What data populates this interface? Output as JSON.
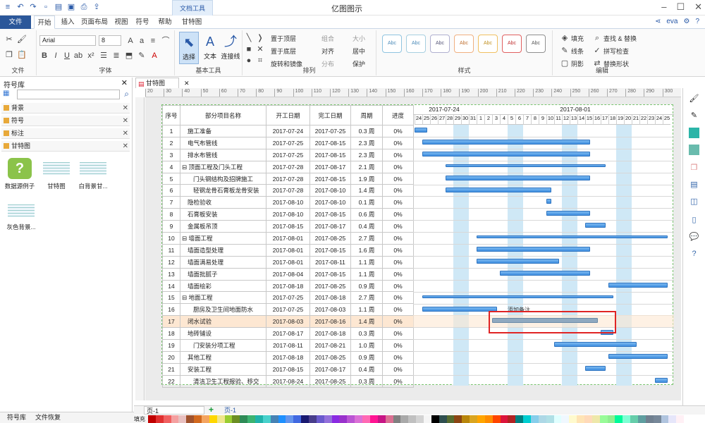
{
  "app": {
    "title": "亿图图示",
    "context_tab": "文档工具",
    "user": "eva"
  },
  "menu": {
    "file": "文件",
    "tabs": [
      "开始",
      "插入",
      "页面布局",
      "视图",
      "符号",
      "帮助",
      "甘特图"
    ]
  },
  "ribbon": {
    "font_name": "Arial",
    "font_size": "8",
    "groups": {
      "file": "文件",
      "font": "字体",
      "basic": "基本工具",
      "arrange": "排列",
      "style": "样式",
      "edit": "编辑"
    },
    "basic_tools": {
      "select": "选择",
      "text": "文本",
      "connector": "连接线"
    },
    "arrange": {
      "bring_front": "置于顶层",
      "send_back": "置于底层",
      "rotate": "旋转和镜像",
      "group": "组合",
      "align": "对齐",
      "distribute": "分布",
      "size": "大小",
      "center": "居中",
      "protect": "保护"
    },
    "style_label": "Abc",
    "right": {
      "fill": "填充",
      "line": "线条",
      "shadow": "阴影",
      "find_replace": "查找 & 替换",
      "spell": "拼写检查",
      "replace_shape": "替换形状"
    }
  },
  "sidebar": {
    "title": "符号库",
    "sections": [
      "背景",
      "符号",
      "标注",
      "甘特图"
    ],
    "thumbs": [
      "数据源例子",
      "甘特图",
      "白背景甘...",
      "灰色背景..."
    ],
    "bottom_tabs": [
      "符号库",
      "文件恢复"
    ]
  },
  "document_tab": "甘特图",
  "ruler_marks": [
    "20",
    "30",
    "40",
    "50",
    "60",
    "70",
    "80",
    "90",
    "100",
    "110",
    "120",
    "130",
    "140",
    "150",
    "160",
    "170",
    "180",
    "190",
    "200",
    "210",
    "220",
    "230",
    "240",
    "250",
    "260",
    "270",
    "280",
    "290",
    "300"
  ],
  "gantt": {
    "headers": [
      "序号",
      "部分项目名称",
      "开工日期",
      "完工日期",
      "周期",
      "进度"
    ],
    "period1": "2017-07-24",
    "period2": "2017-08-01",
    "days": [
      "24",
      "25",
      "26",
      "27",
      "28",
      "29",
      "30",
      "31",
      "1",
      "2",
      "3",
      "4",
      "5",
      "6",
      "7",
      "8",
      "9",
      "10",
      "11",
      "12",
      "13",
      "14",
      "15",
      "16",
      "17",
      "18",
      "19",
      "20",
      "21",
      "22",
      "23",
      "24",
      "25"
    ],
    "note": "添加备注",
    "rows": [
      {
        "id": "1",
        "name": "施工准备",
        "start": "2017-07-24",
        "end": "2017-07-25",
        "dur": "0.3 周",
        "pct": "0%"
      },
      {
        "id": "2",
        "name": "电气布管线",
        "start": "2017-07-25",
        "end": "2017-08-15",
        "dur": "2.3 周",
        "pct": "0%"
      },
      {
        "id": "3",
        "name": "排水布管线",
        "start": "2017-07-25",
        "end": "2017-08-15",
        "dur": "2.3 周",
        "pct": "0%"
      },
      {
        "id": "4",
        "name": "⊟ 顶面工程及门头工程",
        "start": "2017-07-28",
        "end": "2017-08-17",
        "dur": "2.1 周",
        "pct": "0%"
      },
      {
        "id": "5",
        "name": "门头钢结构及招牌施工",
        "start": "2017-07-28",
        "end": "2017-08-15",
        "dur": "1.9 周",
        "pct": "0%"
      },
      {
        "id": "6",
        "name": "轻钢龙骨石膏板龙骨安装",
        "start": "2017-07-28",
        "end": "2017-08-10",
        "dur": "1.4 周",
        "pct": "0%"
      },
      {
        "id": "7",
        "name": "隐检验收",
        "start": "2017-08-10",
        "end": "2017-08-10",
        "dur": "0.1 周",
        "pct": "0%"
      },
      {
        "id": "8",
        "name": "石膏板安装",
        "start": "2017-08-10",
        "end": "2017-08-15",
        "dur": "0.6 周",
        "pct": "0%"
      },
      {
        "id": "9",
        "name": "金属板吊顶",
        "start": "2017-08-15",
        "end": "2017-08-17",
        "dur": "0.4 周",
        "pct": "0%"
      },
      {
        "id": "10",
        "name": "⊟ 墙面工程",
        "start": "2017-08-01",
        "end": "2017-08-25",
        "dur": "2.7 周",
        "pct": "0%"
      },
      {
        "id": "11",
        "name": "墙面造型处理",
        "start": "2017-08-01",
        "end": "2017-08-15",
        "dur": "1.6 周",
        "pct": "0%"
      },
      {
        "id": "12",
        "name": "墙面满易处理",
        "start": "2017-08-01",
        "end": "2017-08-11",
        "dur": "1.1 周",
        "pct": "0%"
      },
      {
        "id": "13",
        "name": "墙面批腻子",
        "start": "2017-08-04",
        "end": "2017-08-15",
        "dur": "1.1 周",
        "pct": "0%"
      },
      {
        "id": "14",
        "name": "墙面绘彩",
        "start": "2017-08-18",
        "end": "2017-08-25",
        "dur": "0.9 周",
        "pct": "0%"
      },
      {
        "id": "15",
        "name": "⊟ 地面工程",
        "start": "2017-07-25",
        "end": "2017-08-18",
        "dur": "2.7 周",
        "pct": "0%"
      },
      {
        "id": "16",
        "name": "厨房及卫生间地面防水",
        "start": "2017-07-25",
        "end": "2017-08-03",
        "dur": "1.1 周",
        "pct": "0%"
      },
      {
        "id": "17",
        "name": "闭水试验",
        "start": "2017-08-03",
        "end": "2017-08-16",
        "dur": "1.4 周",
        "pct": "0%"
      },
      {
        "id": "18",
        "name": "地砖铺设",
        "start": "2017-08-17",
        "end": "2017-08-18",
        "dur": "0.3 周",
        "pct": "0%"
      },
      {
        "id": "19",
        "name": "门安装分项工程",
        "start": "2017-08-11",
        "end": "2017-08-21",
        "dur": "1.0 周",
        "pct": "0%"
      },
      {
        "id": "20",
        "name": "其他工程",
        "start": "2017-08-18",
        "end": "2017-08-25",
        "dur": "0.9 周",
        "pct": "0%"
      },
      {
        "id": "21",
        "name": "安装工程",
        "start": "2017-08-15",
        "end": "2017-08-17",
        "dur": "0.4 周",
        "pct": "0%"
      },
      {
        "id": "22",
        "name": "清洁卫生工程报验、移交",
        "start": "2017-08-24",
        "end": "2017-08-25",
        "dur": "0.3 周",
        "pct": "0%"
      }
    ]
  },
  "page_tab": {
    "current": "页-1",
    "active": "页-1"
  },
  "status": {
    "fill": "填充"
  },
  "colors": {
    "accent": "#2b579a",
    "bar": "#3f8fe0",
    "weekend": "#cfe8f6",
    "highlight": "#fde7d2",
    "selection": "#e02424"
  },
  "palette": [
    "#c00000",
    "#e03030",
    "#f06060",
    "#f4a0a0",
    "#e8c0c0",
    "#a0522d",
    "#d2691e",
    "#f4a460",
    "#ffd700",
    "#f0e68c",
    "#9acd32",
    "#6b8e23",
    "#2e8b57",
    "#3cb371",
    "#20b2aa",
    "#48d1cc",
    "#4682b4",
    "#1e90ff",
    "#6495ed",
    "#4169e1",
    "#191970",
    "#483d8b",
    "#6a5acd",
    "#9370db",
    "#8a2be2",
    "#9932cc",
    "#ba55d3",
    "#da70d6",
    "#ff69b4",
    "#ff1493",
    "#c71585",
    "#db7093",
    "#808080",
    "#a9a9a9",
    "#c0c0c0",
    "#d3d3d3",
    "#f5f5f5",
    "#000000",
    "#2f4f4f",
    "#556b2f",
    "#8b4513",
    "#b8860b",
    "#daa520",
    "#ffa500",
    "#ff8c00",
    "#ff4500",
    "#dc143c",
    "#b22222",
    "#008080",
    "#00ced1",
    "#87ceeb",
    "#add8e6",
    "#b0e0e6",
    "#e0ffff",
    "#f0f8ff",
    "#fffacd",
    "#ffe4b5",
    "#ffdab9",
    "#eee8aa",
    "#98fb98",
    "#90ee90",
    "#00fa9a",
    "#7fffd4",
    "#66cdaa",
    "#5f9ea0",
    "#708090",
    "#778899",
    "#b0c4de",
    "#e6e6fa",
    "#fff0f5"
  ]
}
